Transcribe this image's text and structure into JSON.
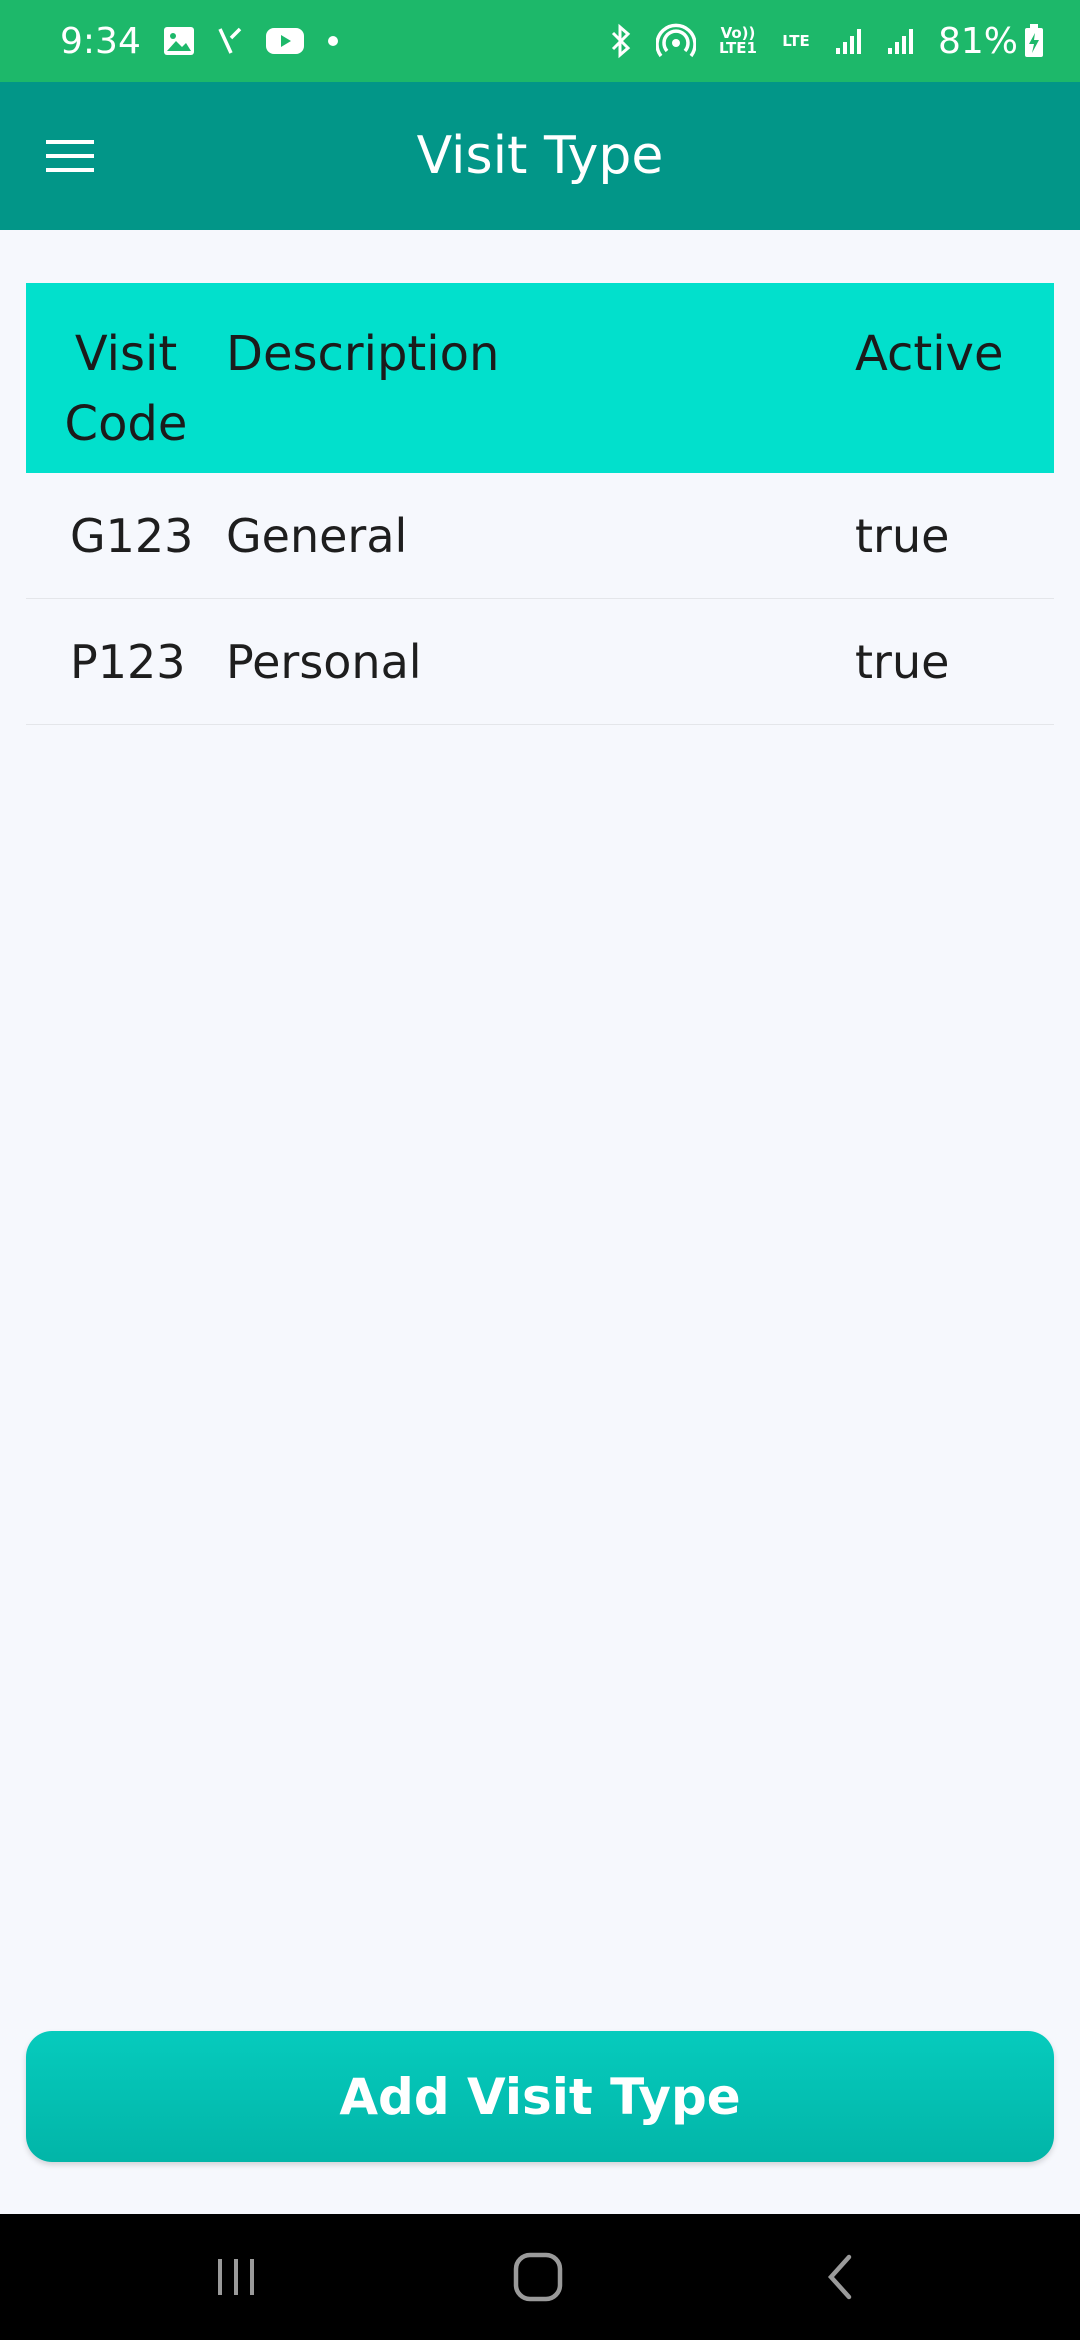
{
  "status_bar": {
    "time": "9:34",
    "battery": "81%",
    "volte_label": "Vo)) LTE1",
    "lte_label": "LTE",
    "icons": [
      "image-icon",
      "missed-call-icon",
      "youtube-icon",
      "dot-icon",
      "bluetooth-icon",
      "hotspot-icon",
      "volte-icon",
      "lte-icon",
      "signal-icon",
      "signal-icon",
      "battery-charging-icon"
    ]
  },
  "app_bar": {
    "title": "Visit Type",
    "menu_icon": "menu-icon"
  },
  "table": {
    "headers": {
      "code_line1": "Visit",
      "code_line2": "Code",
      "description": "Description",
      "active": "Active"
    },
    "rows": [
      {
        "code": "G123",
        "description": "General",
        "active": "true"
      },
      {
        "code": "P123",
        "description": "Personal",
        "active": "true"
      }
    ]
  },
  "add_button": {
    "label": "Add Visit Type"
  },
  "nav_bar": {
    "icons": [
      "recent-apps-icon",
      "home-icon",
      "back-icon"
    ]
  },
  "colors": {
    "status_bar": "#1db86a",
    "app_bar": "#029688",
    "table_header": "#02e0cc",
    "button": "#06cbbd",
    "background": "#f6f8fd"
  }
}
